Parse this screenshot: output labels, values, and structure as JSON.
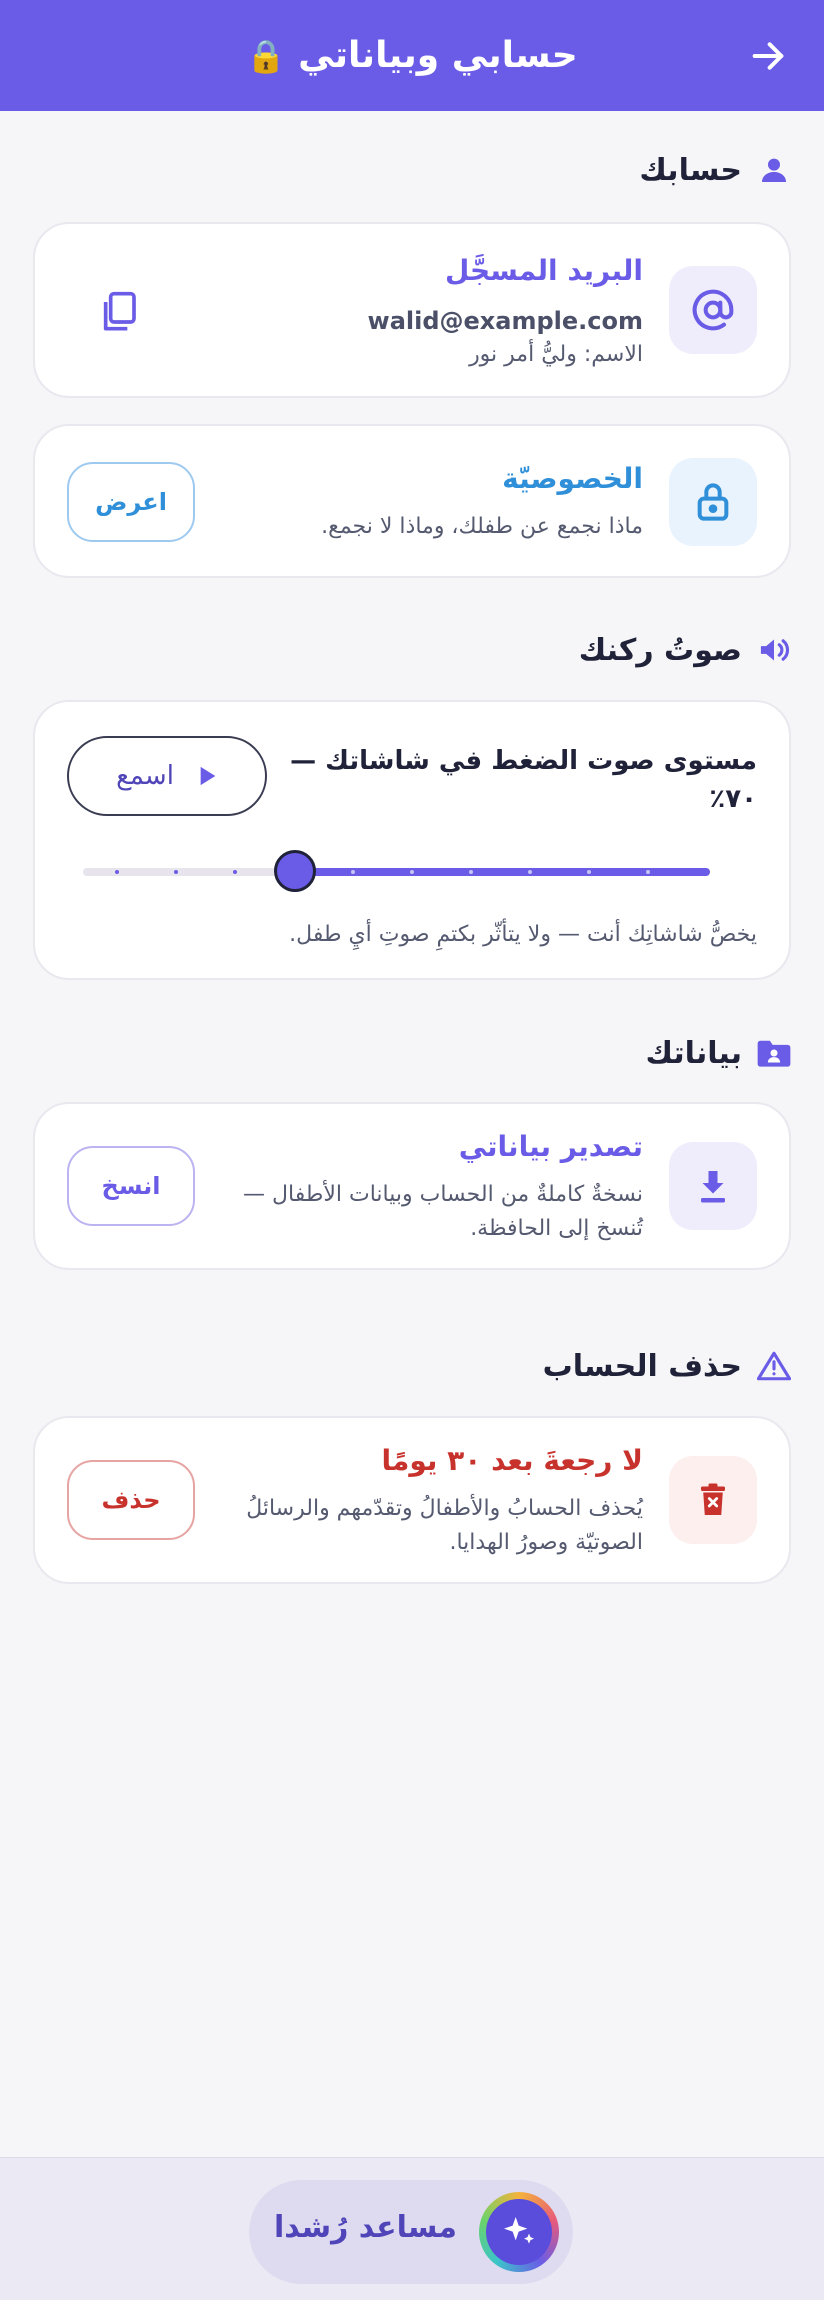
{
  "header": {
    "title": "حسابي وبياناتي",
    "lock_glyph": "🔒",
    "back_icon": "arrow-right-icon"
  },
  "account": {
    "heading": "حسابك",
    "email_card": {
      "title": "البريد المسجَّل",
      "email": "walid@example.com",
      "name_line": "الاسم: وليُّ أمر نور",
      "icon": "at-sign-icon",
      "copy_icon": "copy-icon"
    },
    "privacy_card": {
      "title": "الخصوصيّة",
      "text": "ماذا نجمع عن طفلك، وماذا لا نجمع.",
      "button": "اعرض",
      "icon": "lock-icon"
    }
  },
  "voice": {
    "heading": "صوتُ ركنك",
    "title_line1": "مستوى صوت الضغط في شاشاتك —",
    "title_line2": "٧٠٪",
    "listen_button": "اسمع",
    "level": 0.7,
    "note": "يخصُّ شاشاتِك أنت — ولا يتأثّر بكتمِ صوتِ أيِ طفل."
  },
  "data": {
    "heading": "بياناتك",
    "export_card": {
      "title": "تصدير بياناتي",
      "text_line1": "نسخةٌ كاملةٌ من الحساب وبيانات الأطفال —",
      "text_line2": "تُنسخ إلى الحافظة.",
      "button": "انسخ",
      "icon": "download-icon"
    }
  },
  "delete": {
    "heading": "حذف الحساب",
    "card": {
      "title": "لا رجعةَ بعد ٣٠ يومًا",
      "text_line1": "يُحذف الحسابُ والأطفالُ وتقدّمهم والرسائلُ",
      "text_line2": "الصوتيّة وصورُ الهدايا.",
      "button": "حذف",
      "icon": "trash-icon"
    }
  },
  "assistant": {
    "label": "مساعد رُشدا",
    "icon": "sparkles-icon"
  },
  "colors": {
    "primary": "#6a5ce6",
    "privacy_blue": "#2f8fd8",
    "danger": "#c8322c",
    "text_dark": "#1f2238"
  }
}
